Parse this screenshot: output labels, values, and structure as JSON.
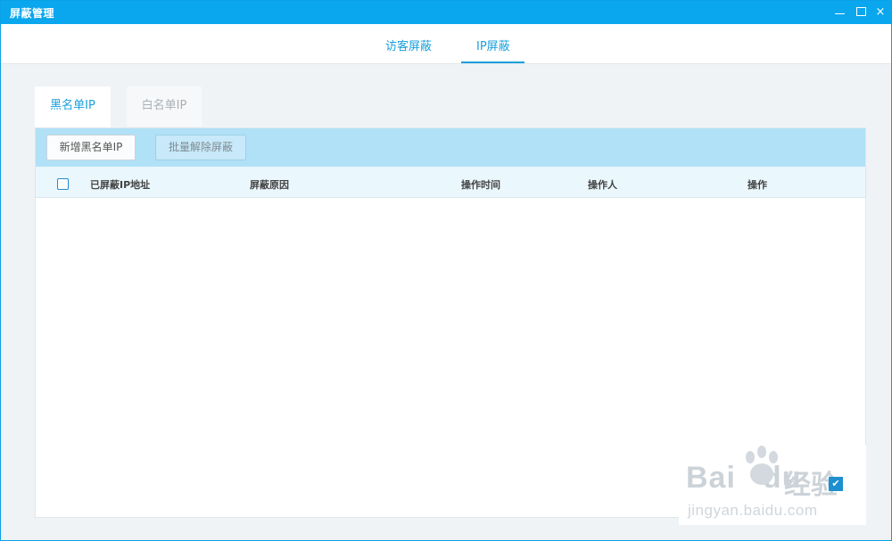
{
  "window": {
    "title": "屏蔽管理",
    "controls": {
      "minimize": "minimize-icon",
      "maximize": "maximize-icon",
      "close": "×"
    }
  },
  "top_tabs": [
    {
      "label": "访客屏蔽",
      "active": false
    },
    {
      "label": "IP屏蔽",
      "active": true
    }
  ],
  "sub_tabs": [
    {
      "label": "黑名单IP",
      "active": true
    },
    {
      "label": "白名单IP",
      "active": false
    }
  ],
  "toolbar": {
    "add_label": "新增黑名单IP",
    "batch_unblock_label": "批量解除屏蔽"
  },
  "table": {
    "columns": [
      "已屏蔽IP地址",
      "屏蔽原因",
      "操作时间",
      "操作人",
      "操作"
    ],
    "rows": []
  },
  "watermark": {
    "logo_text": "Bai",
    "logo_text2": "du",
    "cn_text": "经验",
    "url": "jingyan.baidu.com"
  },
  "colors": {
    "accent": "#1aa0dc",
    "titlebar": "#0aa7ee",
    "toolbar": "#b0e1f7",
    "table_header": "#eaf7fd"
  }
}
